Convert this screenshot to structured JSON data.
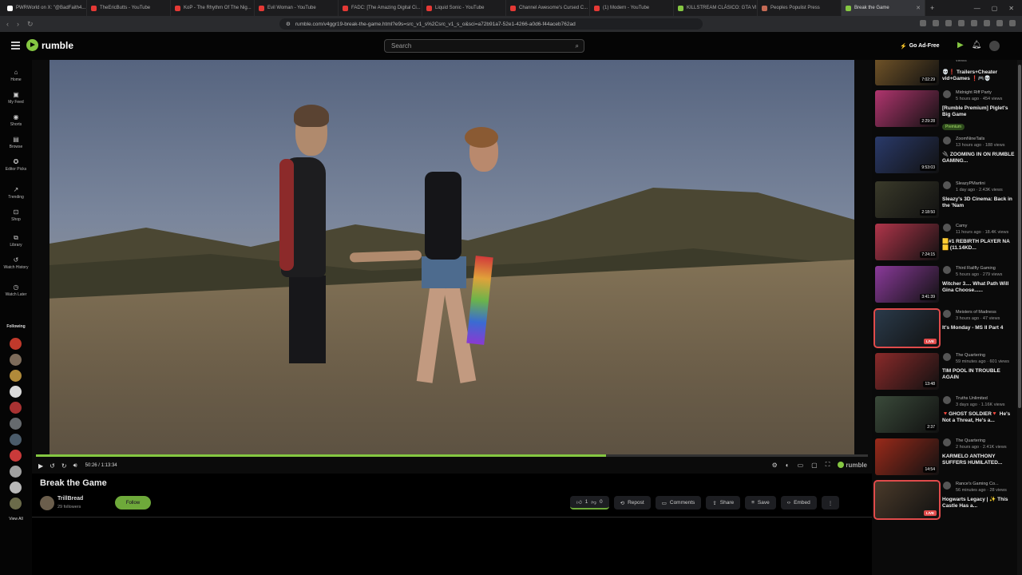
{
  "browser": {
    "tabs": [
      {
        "title": "PWRWorld on X: \"@BadFaith4...",
        "color": "#ffffff"
      },
      {
        "title": "TheEricButts - YouTube",
        "color": "#e53935"
      },
      {
        "title": "KoP - The Rhythm Of The Nig...",
        "color": "#e53935"
      },
      {
        "title": "Evil Woman - YouTube",
        "color": "#e53935"
      },
      {
        "title": "FADC: [The Amazing Digital Ci...",
        "color": "#e53935"
      },
      {
        "title": "Liquid Sonic - YouTube",
        "color": "#e53935"
      },
      {
        "title": "Channel Awesome's Cursed C...",
        "color": "#e53935"
      },
      {
        "title": "(1) Modern - YouTube",
        "color": "#e53935"
      },
      {
        "title": "KILLSTREAM CLÁSICO: GTA VI...",
        "color": "#85c742"
      },
      {
        "title": "Peoples Populist Press",
        "color": "#c56a55"
      },
      {
        "title": "Break the Game",
        "color": "#85c742"
      }
    ],
    "url": "rumble.com/v4ggr19-break-the-game.html?e9s=src_v1_s%2Csrc_v1_s_o&sci=a72b91a7-52e1-4266-a0d6-f44aceb762ad"
  },
  "header": {
    "logo": "rumble",
    "search_placeholder": "Search",
    "go_ad_free": "Go Ad-Free"
  },
  "leftnav": {
    "items": [
      {
        "label": "Home",
        "icon": "home-icon",
        "glyph": "⌂"
      },
      {
        "label": "My Feed",
        "icon": "feed-icon",
        "glyph": "▣"
      },
      {
        "label": "Shorts",
        "icon": "shorts-icon",
        "glyph": "◉"
      },
      {
        "label": "Browse",
        "icon": "browse-icon",
        "glyph": "▤"
      },
      {
        "label": "Editor Picks",
        "icon": "editor-picks-icon",
        "glyph": "✪"
      },
      {
        "label": "Trending",
        "icon": "trending-icon",
        "glyph": "↗"
      },
      {
        "label": "Shop",
        "icon": "shop-icon",
        "glyph": "⊡"
      },
      {
        "label": "Library",
        "icon": "library-icon",
        "glyph": "⧉"
      },
      {
        "label": "Watch History",
        "icon": "history-icon",
        "glyph": "↺"
      },
      {
        "label": "Watch Later",
        "icon": "clock-icon",
        "glyph": "◷"
      }
    ],
    "following_label": "Following",
    "following_colors": [
      "#c0392b",
      "#7d6b5a",
      "#b08a3a",
      "#d9d9d9",
      "#a83232",
      "#666a6e",
      "#4a5b6a",
      "#c93a3a",
      "#a0a0a0",
      "#b8b8b8",
      "#6b6b4a"
    ],
    "view_all": "View All"
  },
  "player": {
    "timecode": "50:26 / 1:13:34",
    "progress": 0.6855,
    "brand": "rumble"
  },
  "video": {
    "title": "Break the Game",
    "channel": "TrillBread",
    "followers": "29 followers",
    "follow_label": "Follow",
    "likes": "1",
    "dislikes": "0",
    "actions": {
      "repost": "Repost",
      "comments": "Comments",
      "share": "Share",
      "save": "Save",
      "embed": "Embed"
    }
  },
  "sidebar": {
    "cards": [
      {
        "duration": "7:02:29",
        "channel": "",
        "meta": "views",
        "title": "💀❗ Trailers+Cheater vid+Games ❗🎮💀",
        "thumb": "#7a5a2a",
        "live": false,
        "premium": false
      },
      {
        "duration": "2:29:28",
        "channel": "Midnight Riff Party",
        "meta": "5 hours ago · 454 views",
        "title": "[Rumble Premium] Piglet's Big Game",
        "thumb": "#b0356e",
        "live": false,
        "premium": true,
        "premium_label": "Premium"
      },
      {
        "duration": "9:53:03",
        "channel": "ZoomNineTails",
        "meta": "13 hours ago · 188 views",
        "title": "🔌 ZOOMING IN ON RUMBLE GAMING...",
        "thumb": "#2a3a6a",
        "live": false,
        "premium": false
      },
      {
        "duration": "2:18:50",
        "channel": "SleazyPMartini",
        "meta": "1 day ago · 2.43K views",
        "title": "Sleazy's 3D Cinema: Back in the 'Nam",
        "thumb": "#3a3a2a",
        "live": false,
        "premium": false
      },
      {
        "duration": "7:24:15",
        "channel": "Camy",
        "meta": "11 hours ago · 18.4K views",
        "title": "🟨#1 REBIRTH PLAYER NA🟨 (11.14KD...",
        "thumb": "#b0354a",
        "live": false,
        "premium": false
      },
      {
        "duration": "3:41:39",
        "channel": "Third Railfly Gaming",
        "meta": "5 hours ago · 279 views",
        "title": "Witcher 3.... What Path Will Gina Choose......",
        "thumb": "#8a3a9a",
        "live": false,
        "premium": false
      },
      {
        "duration": "LIVE",
        "channel": "Meisters of Madness",
        "meta": "3 hours ago · 47 views",
        "title": "It's Monday - MS II Part 4",
        "thumb": "#2a3a4a",
        "live": true,
        "premium": false
      },
      {
        "duration": "13:48",
        "channel": "The Quartering",
        "meta": "59 minutes ago · 601 views",
        "title": "TIM POOL IN TROUBLE AGAIN",
        "thumb": "#8a2a2a",
        "live": false,
        "premium": false
      },
      {
        "duration": "2:37",
        "channel": "Truths Unlimited",
        "meta": "3 days ago · 1.16K views",
        "title": "🔻GHOST SOLDIER🔻 He's Not a Threat, He's a...",
        "thumb": "#3a4a3a",
        "live": false,
        "premium": false
      },
      {
        "duration": "14:54",
        "channel": "The Quartering",
        "meta": "2 hours ago · 2.41K views",
        "title": "KARMELO ANTHONY SUFFERS HUMILATED...",
        "thumb": "#9a2a1a",
        "live": false,
        "premium": false
      },
      {
        "duration": "LIVE",
        "channel": "Rance's Gaming Co...",
        "meta": "56 minutes ago · 28 views",
        "title": "Hogwarts Legacy | ✨ This Castle Has a...",
        "thumb": "#4a3a2a",
        "live": true,
        "premium": false
      }
    ]
  }
}
